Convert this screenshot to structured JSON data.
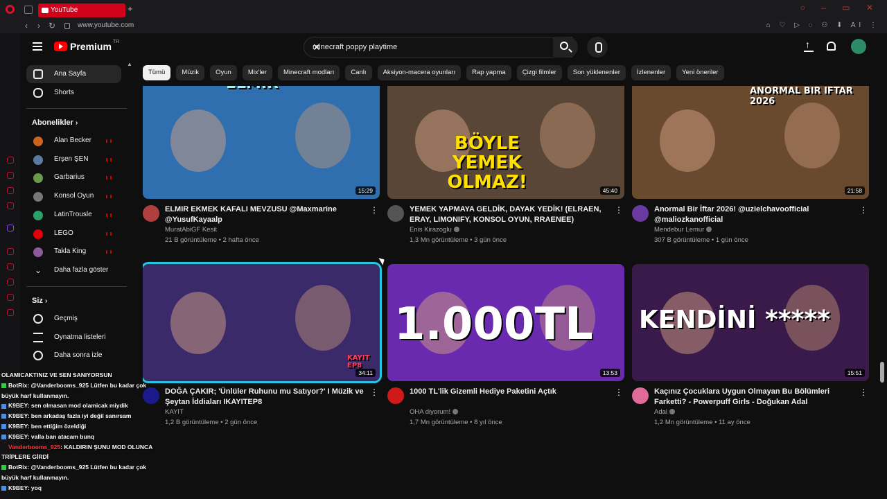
{
  "browser": {
    "tab_title": "YouTube",
    "new_tab": "+",
    "url": "www.youtube.com",
    "ext_ai": "AI"
  },
  "header": {
    "logo": "Premium",
    "logo_region": "TR",
    "search_query": "minecraft poppy playtime",
    "clear": "✕"
  },
  "sidebar": {
    "home": "Ana Sayfa",
    "shorts": "Shorts",
    "subs_title": "Abonelikler",
    "subscriptions": [
      {
        "label": "Alan Becker",
        "color": "#c8641e"
      },
      {
        "label": "Erşen ŞEN",
        "color": "#5a7aa0"
      },
      {
        "label": "Garbarius",
        "color": "#6a9a4a"
      },
      {
        "label": "Konsol Oyun",
        "color": "#777777"
      },
      {
        "label": "LatinTrousle",
        "color": "#2aa06a"
      },
      {
        "label": "LEGO",
        "color": "#e3000b"
      },
      {
        "label": "Takla King",
        "color": "#8a5a9a"
      }
    ],
    "show_more": "Daha fazla göster",
    "you_title": "Siz",
    "history": "Geçmiş",
    "playlists": "Oynatma listeleri",
    "watch_later": "Daha sonra izle"
  },
  "chips": [
    "Tümü",
    "Müzik",
    "Oyun",
    "Mix'ler",
    "Minecraft modları",
    "Canlı",
    "Aksiyon-macera oyunları",
    "Rap yapma",
    "Çizgi filmler",
    "Son yüklenenler",
    "İzlenenler",
    "Yeni öneriler"
  ],
  "videos": [
    {
      "title": "ELMIR EKMEK KAFALI MEVZUSU @Maxmarine @YusufKayaalp",
      "channel": "MuratAbiGF Kesit",
      "stats": "21 B görüntüleme • 2 hafta önce",
      "duration": "15:29",
      "thumb_text": "ELMIR",
      "bg": "#2f6fb0",
      "av": "#b04040"
    },
    {
      "title": "YEMEK YAPMAYA GELDİK, DAYAK YEDİK! (ELRAEN, ERAY, LIMONIFY, KONSOL OYUN, RRAENEE)",
      "channel": "Enis Kirazoglu",
      "stats": "1,3 Mn görüntüleme • 3 gün önce",
      "duration": "45:40",
      "thumb_text": "BÖYLE YEMEK OLMAZ!",
      "bg": "#5a4636",
      "av": "#555555"
    },
    {
      "title": "Anormal Bir İftar 2026!  @uzielchavoofficial @maliozkanofficial",
      "channel": "Mendebur Lemur",
      "stats": "307 B görüntüleme • 1 gün önce",
      "duration": "21:58",
      "thumb_text": "ANORMAL BIR IFTAR 2026",
      "bg": "#6a4a2e",
      "av": "#6a3aa0"
    },
    {
      "title": "DOĞA ÇAKIR; 'Ünlüler Ruhunu mu Satıyor?' I Müzik ve Şeytan İddiaları IKAYITEP8",
      "channel": "KAYIT",
      "stats": "1,2 B görüntüleme • 2 gün önce",
      "duration": "34:11",
      "thumb_text": "KAYIT EP8",
      "bg": "#3a2a6a",
      "av": "#1a1a8a"
    },
    {
      "title": "1000 TL'lik Gizemli Hediye Paketini Açtık",
      "channel": "OHA diyorum!",
      "stats": "1,7 Mn görüntüleme • 8 yıl önce",
      "duration": "13:53",
      "thumb_text": "1.000TL",
      "bg": "#6a2ab0",
      "av": "#d01a1a"
    },
    {
      "title": "Kaçınız Çocuklara Uygun Olmayan Bu Bölümleri Farketti? - Powerpuff Girls - Doğukan Adal",
      "channel": "Adal",
      "stats": "1,2 Mn görüntüleme • 11 ay önce",
      "duration": "15:51",
      "thumb_text": "KENDİNİ *****",
      "bg": "#3a1a4a",
      "av": "#e06a9a"
    }
  ],
  "chat": [
    {
      "name": "",
      "text": "OLAMICAKTINIZ VE SEN SANIYORSUN",
      "red": false
    },
    {
      "name": "BotRix",
      "text": ": @Vanderbooms_925 Lütfen bu kadar çok",
      "red": false
    },
    {
      "name": "",
      "text": "büyük harf kullanmayın.",
      "red": false
    },
    {
      "name": "K9BEY",
      "text": ": sen olmasan mod olamicak miydik",
      "red": false
    },
    {
      "name": "K9BEY",
      "text": ": ben arkadaş fazla iyi değil sanırsam",
      "red": false
    },
    {
      "name": "K9BEY",
      "text": ": ben ettiğim özeldiği",
      "red": false
    },
    {
      "name": "K9BEY",
      "text": ": valla ban atacam bunq",
      "red": false
    },
    {
      "name": "Vanderbooms_925",
      "text": ": KALDIRIN ŞUNU MOD OLUNCA",
      "red": true
    },
    {
      "name": "",
      "text": "TRİPLERE GİRDİ",
      "red": false
    },
    {
      "name": "BotRix",
      "text": ": @Vanderbooms_925 Lütfen bu kadar çok",
      "red": false
    },
    {
      "name": "",
      "text": "büyük harf kullanmayın.",
      "red": false
    },
    {
      "name": "K9BEY",
      "text": ": yoq",
      "red": false
    }
  ]
}
